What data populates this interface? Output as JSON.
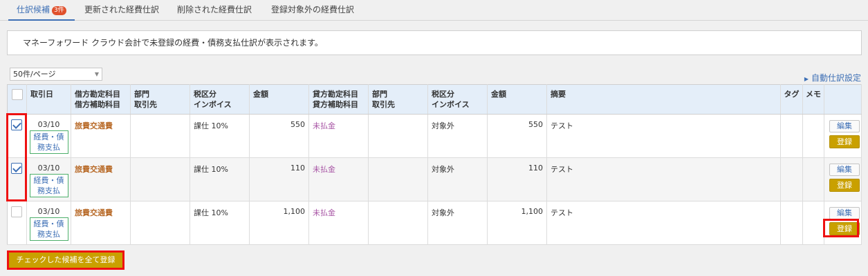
{
  "tabs": [
    {
      "label": "仕訳候補",
      "badge": "3件"
    },
    {
      "label": "更新された経費仕訳"
    },
    {
      "label": "削除された経費仕訳"
    },
    {
      "label": "登録対象外の経費仕訳"
    }
  ],
  "notice": "マネーフォワード クラウド会計で未登録の経費・債務支払仕訳が表示されます。",
  "per_page": "50件/ページ",
  "auto_setting": "自動仕訳設定",
  "columns": {
    "date": "取引日",
    "debit_account": "借方勘定科目",
    "debit_sub": "借方補助科目",
    "debit_dept": "部門",
    "debit_partner": "取引先",
    "debit_tax": "税区分",
    "debit_invoice": "インボイス",
    "debit_amount": "金額",
    "credit_account": "貸方勘定科目",
    "credit_sub": "貸方補助科目",
    "credit_dept": "部門",
    "credit_partner": "取引先",
    "credit_tax": "税区分",
    "credit_invoice": "インボイス",
    "credit_amount": "金額",
    "memo_desc": "摘要",
    "tag": "タグ",
    "memo": "メモ"
  },
  "rows": [
    {
      "checked": true,
      "date": "03/10",
      "source": "経費・債務支払",
      "debit_account": "旅費交通費",
      "debit_tax": "課仕 10%",
      "debit_amount": "550",
      "credit_account": "未払金",
      "credit_tax": "対象外",
      "credit_amount": "550",
      "description": "テスト"
    },
    {
      "checked": true,
      "date": "03/10",
      "source": "経費・債務支払",
      "debit_account": "旅費交通費",
      "debit_tax": "課仕 10%",
      "debit_amount": "110",
      "credit_account": "未払金",
      "credit_tax": "対象外",
      "credit_amount": "110",
      "description": "テスト"
    },
    {
      "checked": false,
      "date": "03/10",
      "source": "経費・債務支払",
      "debit_account": "旅費交通費",
      "debit_tax": "課仕 10%",
      "debit_amount": "1,100",
      "credit_account": "未払金",
      "credit_tax": "対象外",
      "credit_amount": "1,100",
      "description": "テスト"
    }
  ],
  "buttons": {
    "edit": "編集",
    "register": "登録",
    "bulk_register": "チェックした候補を全て登録"
  },
  "colors": {
    "accent": "#3d6fb5",
    "register": "#c9a000",
    "highlight": "#e11111"
  }
}
